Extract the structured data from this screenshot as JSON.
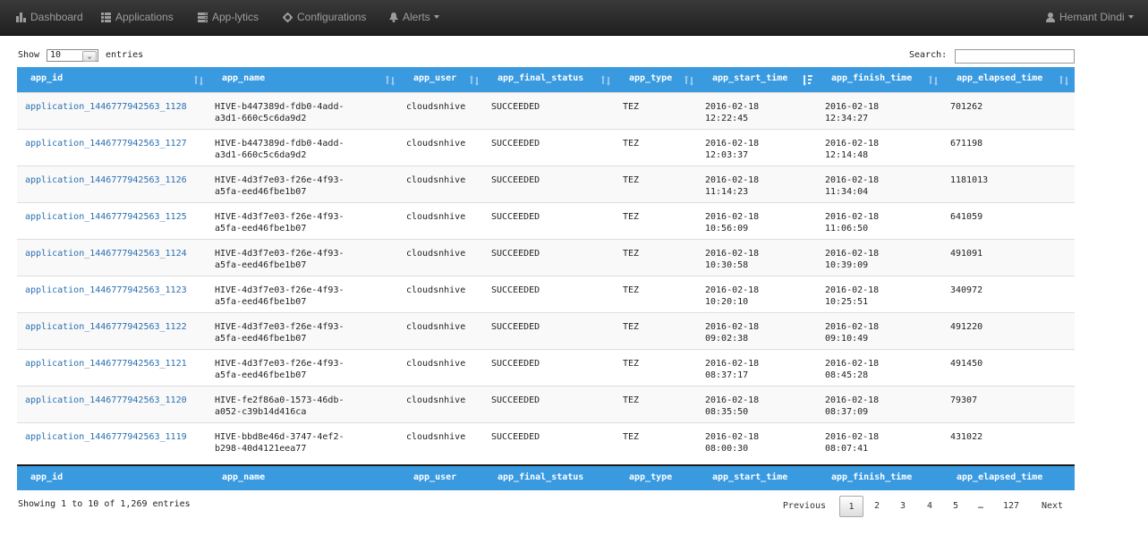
{
  "nav": {
    "dashboard": "Dashboard",
    "applications": "Applications",
    "applytics": "App-lytics",
    "configurations": "Configurations",
    "alerts": "Alerts",
    "user": "Hemant Dindi"
  },
  "controls": {
    "show": "Show",
    "page_length": "10",
    "entries": "entries",
    "search": "Search:",
    "search_value": ""
  },
  "columns": [
    "app_id",
    "app_name",
    "app_user",
    "app_final_status",
    "app_type",
    "app_start_time",
    "app_finish_time",
    "app_elapsed_time"
  ],
  "rows": [
    {
      "app_id": "application_1446777942563_1128",
      "app_name": "HIVE-b447389d-fdb0-4add-\na3d1-660c5c6da9d2",
      "app_user": "cloudsnhive",
      "status": "SUCCEEDED",
      "type": "TEZ",
      "start": "2016-02-18\n12:22:45",
      "finish": "2016-02-18\n12:34:27",
      "elapsed": "701262"
    },
    {
      "app_id": "application_1446777942563_1127",
      "app_name": "HIVE-b447389d-fdb0-4add-\na3d1-660c5c6da9d2",
      "app_user": "cloudsnhive",
      "status": "SUCCEEDED",
      "type": "TEZ",
      "start": "2016-02-18\n12:03:37",
      "finish": "2016-02-18\n12:14:48",
      "elapsed": "671198"
    },
    {
      "app_id": "application_1446777942563_1126",
      "app_name": "HIVE-4d3f7e03-f26e-4f93-\na5fa-eed46fbe1b07",
      "app_user": "cloudsnhive",
      "status": "SUCCEEDED",
      "type": "TEZ",
      "start": "2016-02-18\n11:14:23",
      "finish": "2016-02-18\n11:34:04",
      "elapsed": "1181013"
    },
    {
      "app_id": "application_1446777942563_1125",
      "app_name": "HIVE-4d3f7e03-f26e-4f93-\na5fa-eed46fbe1b07",
      "app_user": "cloudsnhive",
      "status": "SUCCEEDED",
      "type": "TEZ",
      "start": "2016-02-18\n10:56:09",
      "finish": "2016-02-18\n11:06:50",
      "elapsed": "641059"
    },
    {
      "app_id": "application_1446777942563_1124",
      "app_name": "HIVE-4d3f7e03-f26e-4f93-\na5fa-eed46fbe1b07",
      "app_user": "cloudsnhive",
      "status": "SUCCEEDED",
      "type": "TEZ",
      "start": "2016-02-18\n10:30:58",
      "finish": "2016-02-18\n10:39:09",
      "elapsed": "491091"
    },
    {
      "app_id": "application_1446777942563_1123",
      "app_name": "HIVE-4d3f7e03-f26e-4f93-\na5fa-eed46fbe1b07",
      "app_user": "cloudsnhive",
      "status": "SUCCEEDED",
      "type": "TEZ",
      "start": "2016-02-18\n10:20:10",
      "finish": "2016-02-18\n10:25:51",
      "elapsed": "340972"
    },
    {
      "app_id": "application_1446777942563_1122",
      "app_name": "HIVE-4d3f7e03-f26e-4f93-\na5fa-eed46fbe1b07",
      "app_user": "cloudsnhive",
      "status": "SUCCEEDED",
      "type": "TEZ",
      "start": "2016-02-18\n09:02:38",
      "finish": "2016-02-18\n09:10:49",
      "elapsed": "491220"
    },
    {
      "app_id": "application_1446777942563_1121",
      "app_name": "HIVE-4d3f7e03-f26e-4f93-\na5fa-eed46fbe1b07",
      "app_user": "cloudsnhive",
      "status": "SUCCEEDED",
      "type": "TEZ",
      "start": "2016-02-18\n08:37:17",
      "finish": "2016-02-18\n08:45:28",
      "elapsed": "491450"
    },
    {
      "app_id": "application_1446777942563_1120",
      "app_name": "HIVE-fe2f86a0-1573-46db-\na052-c39b14d416ca",
      "app_user": "cloudsnhive",
      "status": "SUCCEEDED",
      "type": "TEZ",
      "start": "2016-02-18\n08:35:50",
      "finish": "2016-02-18\n08:37:09",
      "elapsed": "79307"
    },
    {
      "app_id": "application_1446777942563_1119",
      "app_name": "HIVE-bbd8e46d-3747-4ef2-\nb298-40d4121eea77",
      "app_user": "cloudsnhive",
      "status": "SUCCEEDED",
      "type": "TEZ",
      "start": "2016-02-18\n08:00:30",
      "finish": "2016-02-18\n08:07:41",
      "elapsed": "431022"
    }
  ],
  "info": "Showing 1 to 10 of 1,269 entries",
  "pagination": {
    "previous": "Previous",
    "pages": [
      "1",
      "2",
      "3",
      "4",
      "5",
      "…",
      "127"
    ],
    "next": "Next",
    "current": "1"
  },
  "colors": {
    "header_bg": "#3a9ae0",
    "navbar_bg": "#222222",
    "link": "#2a6fb0"
  }
}
